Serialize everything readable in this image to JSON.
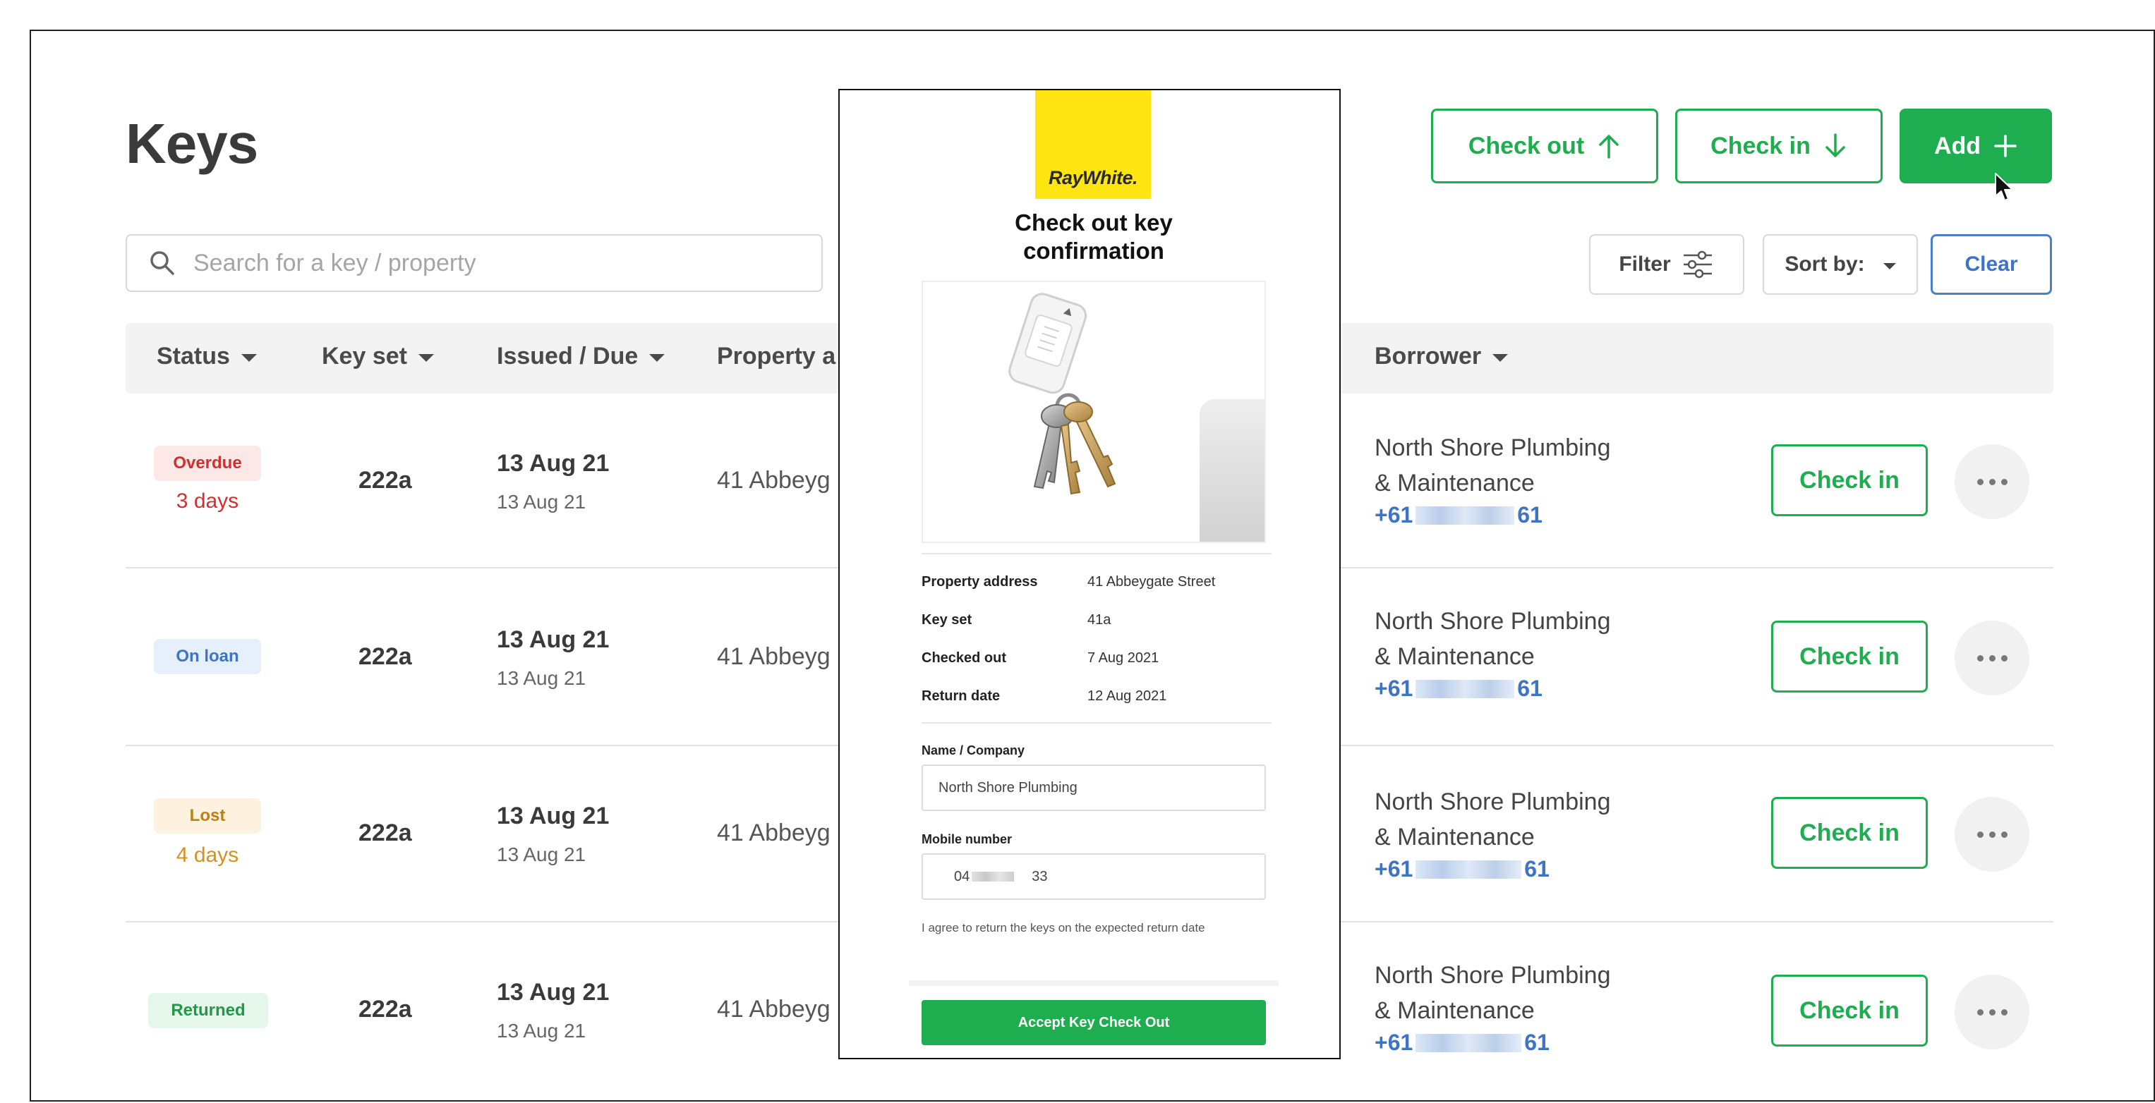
{
  "page": {
    "title": "Keys"
  },
  "header": {
    "check_out_label": "Check out",
    "check_in_label": "Check in",
    "add_label": "Add"
  },
  "search": {
    "placeholder": "Search for a key / property"
  },
  "controls": {
    "filter_label": "Filter",
    "sort_label": "Sort by:",
    "clear_label": "Clear"
  },
  "table": {
    "columns": {
      "status": "Status",
      "key_set": "Key set",
      "issued_due": "Issued / Due",
      "property": "Property a",
      "borrower": "Borrower"
    },
    "rows": [
      {
        "status": "Overdue",
        "status_sub": "3 days",
        "key_set": "222a",
        "issued": "13 Aug 21",
        "due": "13 Aug 21",
        "property": "41 Abbeyg",
        "borrower_line1": "North Shore Plumbing",
        "borrower_line2": "& Maintenance",
        "phone_prefix": "+61",
        "phone_suffix": "61",
        "action": "Check in"
      },
      {
        "status": "On loan",
        "status_sub": "",
        "key_set": "222a",
        "issued": "13 Aug 21",
        "due": "13 Aug 21",
        "property": "41 Abbeyg",
        "borrower_line1": "North Shore Plumbing",
        "borrower_line2": "& Maintenance",
        "phone_prefix": "+61",
        "phone_suffix": "61",
        "action": "Check in"
      },
      {
        "status": "Lost",
        "status_sub": "4 days",
        "key_set": "222a",
        "issued": "13 Aug 21",
        "due": "13 Aug 21",
        "property": "41 Abbeyg",
        "borrower_line1": "North Shore Plumbing",
        "borrower_line2": "& Maintenance",
        "phone_prefix": "+61",
        "phone_suffix": "61",
        "action": "Check in"
      },
      {
        "status": "Returned",
        "status_sub": "",
        "key_set": "222a",
        "issued": "13 Aug 21",
        "due": "13 Aug 21",
        "property": "41 Abbeyg",
        "borrower_line1": "North Shore Plumbing",
        "borrower_line2": "& Maintenance",
        "phone_prefix": "+61",
        "phone_suffix": "61",
        "action": "Check in"
      }
    ]
  },
  "modal": {
    "logo_text": "RayWhite.",
    "title_line1": "Check out key",
    "title_line2": "confirmation",
    "details": [
      {
        "label": "Property address",
        "value": "41 Abbeygate Street"
      },
      {
        "label": "Key set",
        "value": "41a"
      },
      {
        "label": "Checked out",
        "value": "7 Aug 2021"
      },
      {
        "label": "Return date",
        "value": "12 Aug 2021"
      }
    ],
    "name_label": "Name / Company",
    "name_value": "North Shore Plumbing",
    "mobile_label": "Mobile number",
    "mobile_prefix": "04",
    "mobile_suffix": "33",
    "agree_text": "I agree to return the keys on the expected return date",
    "accept_label": "Accept Key Check Out"
  },
  "colors": {
    "accent_green": "#1fae4f",
    "link_blue": "#3d74c4",
    "overdue": "#d03030",
    "on_loan": "#3d74c4",
    "lost": "#d8901c",
    "returned": "#1f9a48",
    "logo_yellow": "#ffe512"
  }
}
